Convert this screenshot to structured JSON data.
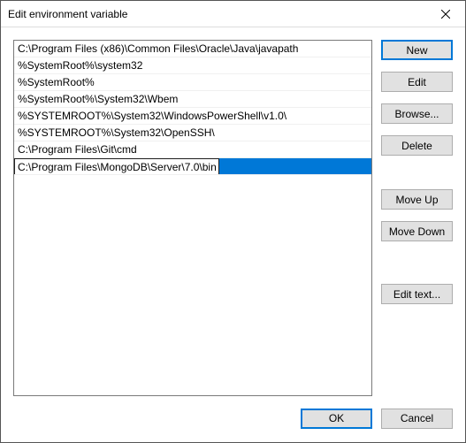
{
  "window": {
    "title": "Edit environment variable"
  },
  "listbox": {
    "items": [
      "C:\\Program Files (x86)\\Common Files\\Oracle\\Java\\javapath",
      "%SystemRoot%\\system32",
      "%SystemRoot%",
      "%SystemRoot%\\System32\\Wbem",
      "%SYSTEMROOT%\\System32\\WindowsPowerShell\\v1.0\\",
      "%SYSTEMROOT%\\System32\\OpenSSH\\",
      "C:\\Program Files\\Git\\cmd"
    ],
    "editing_item": "C:\\Program Files\\MongoDB\\Server\\7.0\\bin"
  },
  "buttons": {
    "new": "New",
    "edit": "Edit",
    "browse": "Browse...",
    "delete": "Delete",
    "moveup": "Move Up",
    "movedown": "Move Down",
    "edittext": "Edit text...",
    "ok": "OK",
    "cancel": "Cancel"
  }
}
